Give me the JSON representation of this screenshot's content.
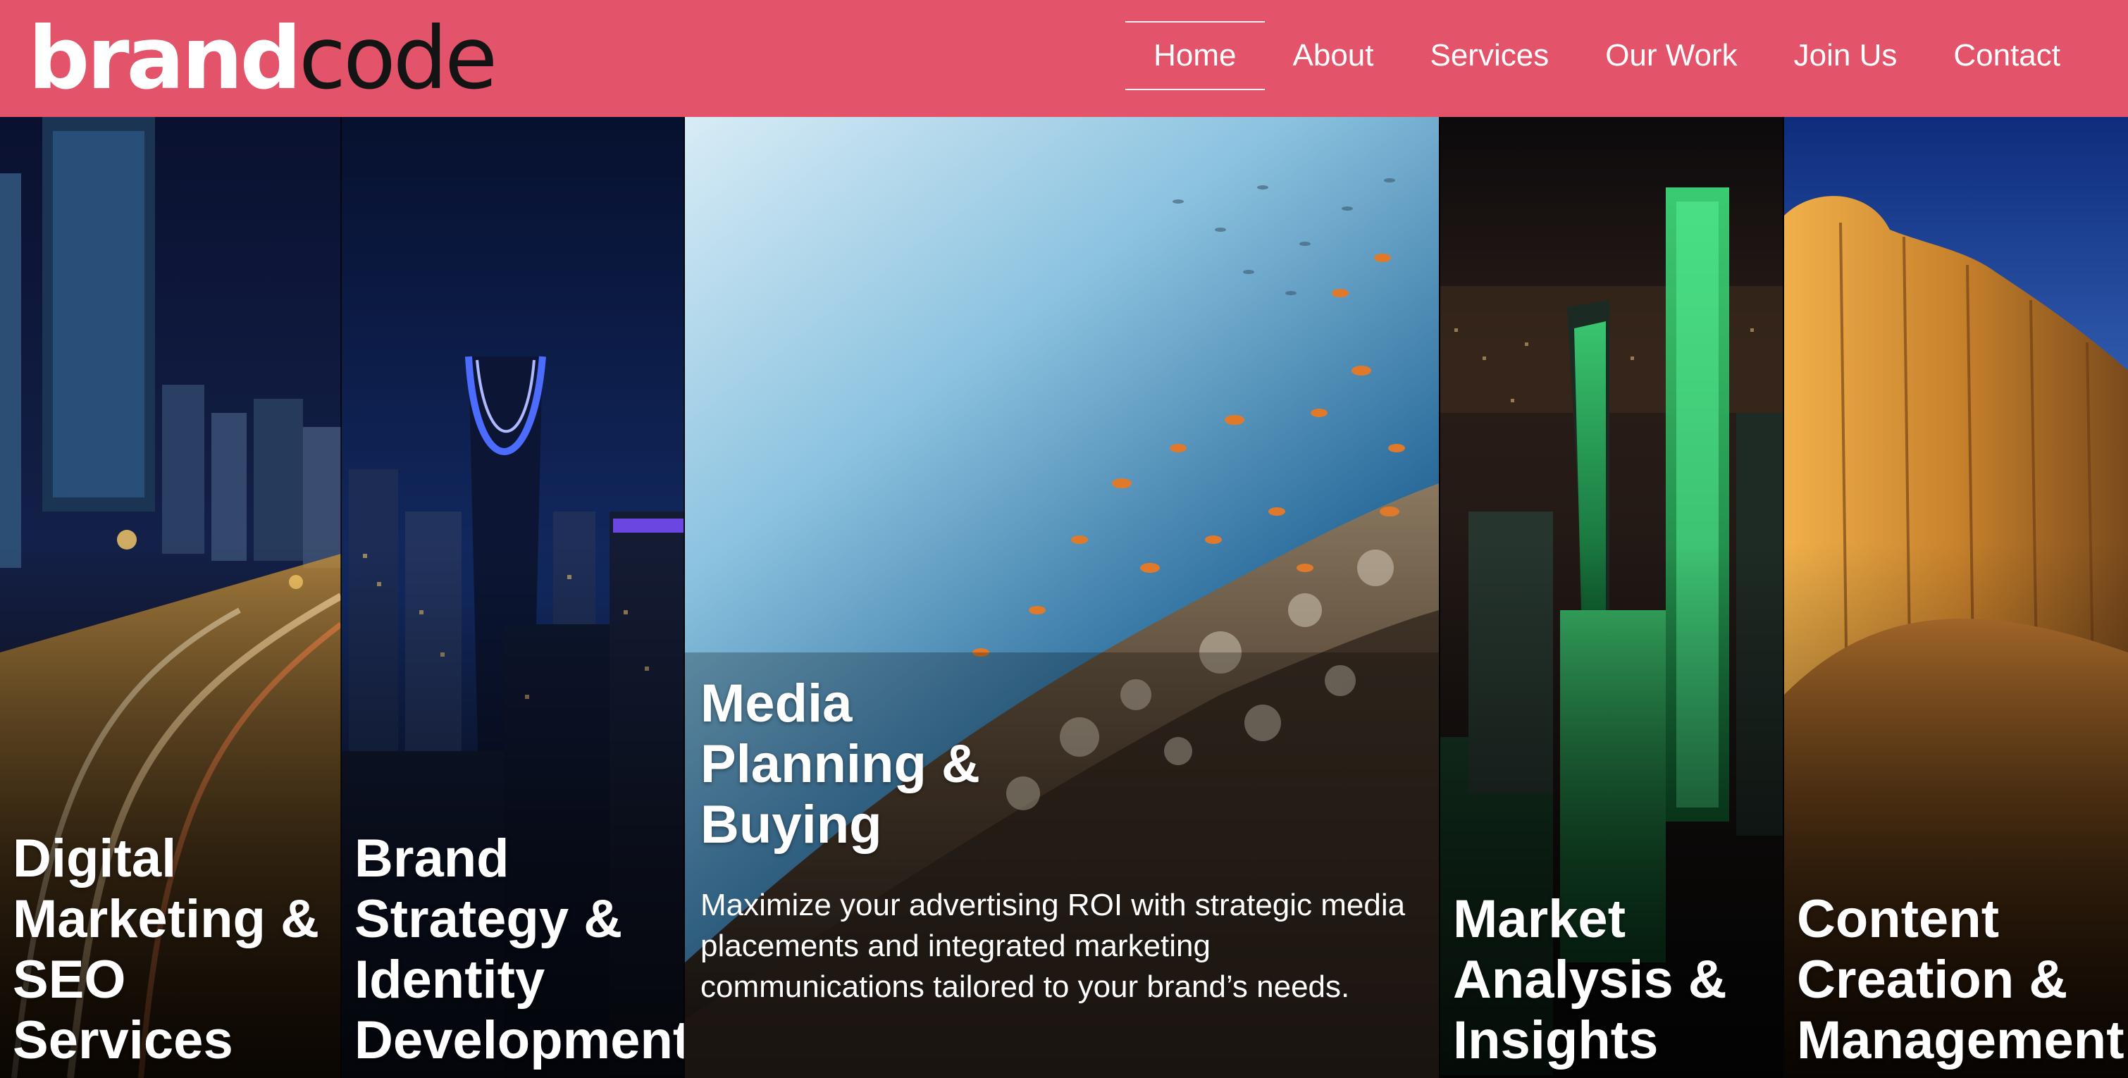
{
  "header": {
    "logo": {
      "part1": "brand",
      "part2": "code"
    },
    "nav": [
      {
        "label": "Home",
        "active": true
      },
      {
        "label": "About",
        "active": false
      },
      {
        "label": "Services",
        "active": false
      },
      {
        "label": "Our Work",
        "active": false
      },
      {
        "label": "Join Us",
        "active": false
      },
      {
        "label": "Contact",
        "active": false
      }
    ]
  },
  "services": [
    {
      "title": "Digital\nMarketing &\nSEO Services"
    },
    {
      "title": "Brand\nStrategy &\nIdentity\nDevelopment"
    },
    {
      "title": "Media\nPlanning &\nBuying",
      "description": "Maximize your advertising ROI with strategic media placements and integrated marketing communications tailored to your brand’s needs.",
      "expanded": true
    },
    {
      "title": "Market\nAnalysis &\nInsights"
    },
    {
      "title": "Content\nCreation &\nManagement"
    }
  ],
  "colors": {
    "header_bg": "#e3546b",
    "logo_primary": "#ffffff",
    "logo_secondary": "#141414"
  }
}
